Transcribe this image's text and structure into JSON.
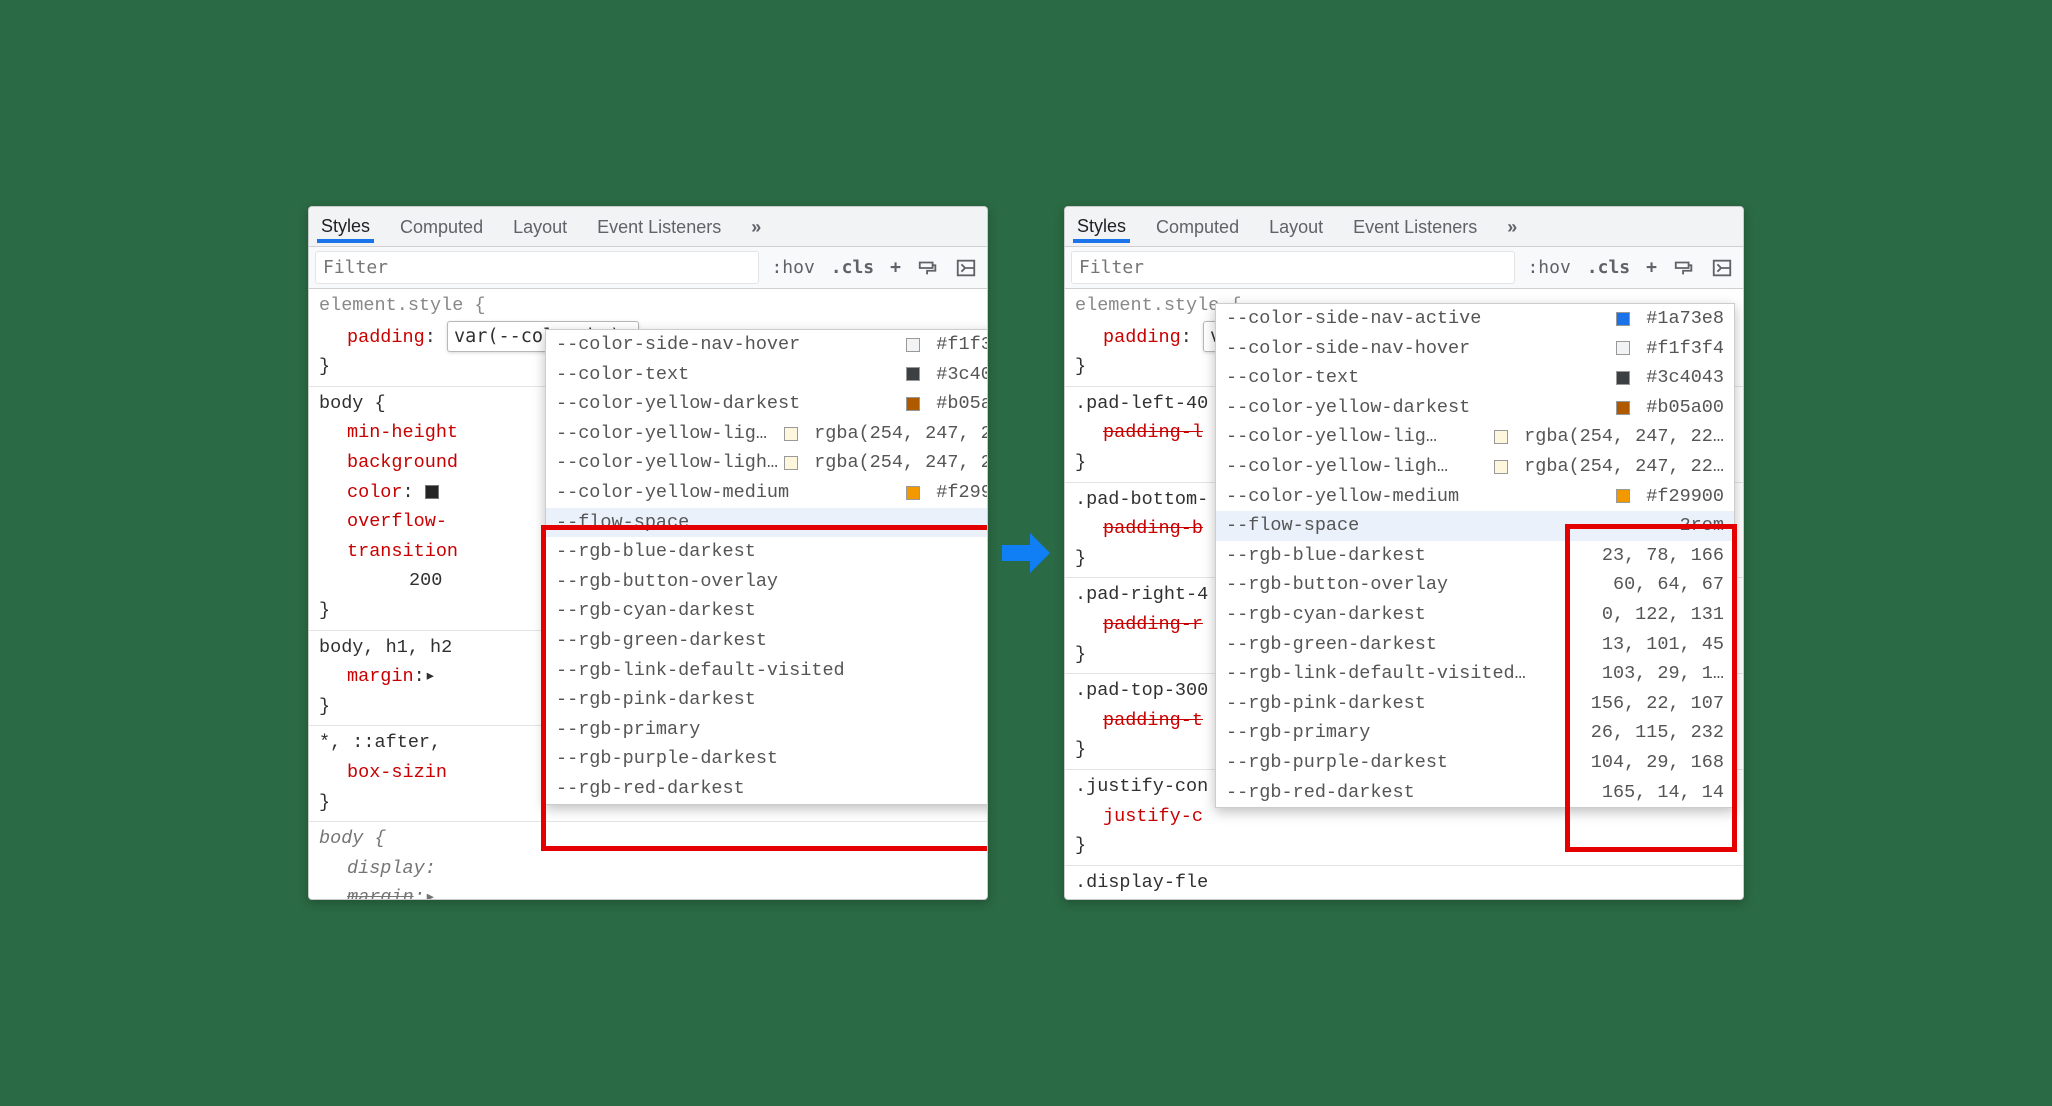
{
  "tabs": {
    "styles": "Styles",
    "computed": "Computed",
    "layout": "Layout",
    "events": "Event Listeners",
    "more": "»"
  },
  "toolbar": {
    "filter_placeholder": "Filter",
    "hov": ":hov",
    "cls": ".cls",
    "plus": "+"
  },
  "element_style": {
    "selector": "element.style {",
    "prop": "padding",
    "value_edit": "var(--color-bg);",
    "close": "}"
  },
  "left_rules": [
    {
      "selector": "body {",
      "props": [
        {
          "name": "min-height",
          "trailing": ""
        },
        {
          "name": "background",
          "trailing": ""
        },
        {
          "name": "color",
          "trailing": "",
          "swatch": "#242424"
        },
        {
          "name": "overflow-",
          "trailing": ""
        },
        {
          "name": "transition",
          "trailing": ""
        }
      ],
      "extra_indent_line": "200",
      "close": "}"
    },
    {
      "selector": "body, h1, h2",
      "props": [
        {
          "name": "margin",
          "trailing": ":▸"
        }
      ],
      "close": "}"
    },
    {
      "selector": "*, ::after,",
      "props": [
        {
          "name": "box-sizin",
          "trailing": ""
        }
      ],
      "close": "}"
    },
    {
      "selector_italic": "body {",
      "props": [
        {
          "name": "display",
          "italic": true,
          "trailing": ":"
        },
        {
          "name": "margin",
          "italic": true,
          "strike": true,
          "trailing": ":▸"
        }
      ]
    }
  ],
  "right_rules": [
    {
      "selector": ".pad-left-40",
      "props": [
        {
          "name": "padding-l",
          "strike": true
        }
      ],
      "close": "}"
    },
    {
      "selector": ".pad-bottom-",
      "props": [
        {
          "name": "padding-b",
          "strike": true
        }
      ],
      "close": "}"
    },
    {
      "selector": ".pad-right-4",
      "props": [
        {
          "name": "padding-r",
          "strike": true
        }
      ],
      "close": "}"
    },
    {
      "selector": ".pad-top-300",
      "props": [
        {
          "name": "padding-t",
          "strike": true
        }
      ],
      "close": "}"
    },
    {
      "selector": ".justify-con",
      "props": [
        {
          "name": "justify-c",
          "trailing": ""
        }
      ],
      "close": "}"
    },
    {
      "selector_partial": ".display-fle"
    }
  ],
  "dropdown_colors": [
    {
      "name": "--color-side-nav-active",
      "swatch": "#1a73e8",
      "val": "#1a73e8",
      "right_only": true
    },
    {
      "name": "--color-side-nav-hover",
      "swatch": "#f1f3f4",
      "val": "#f1f3f4"
    },
    {
      "name": "--color-text",
      "swatch": "#3c4043",
      "val": "#3c4043"
    },
    {
      "name": "--color-yellow-darkest",
      "swatch": "#b05a00",
      "val": "#b05a00"
    },
    {
      "name": "--color-yellow-lig…",
      "swatch": "rgba(254,247,222,1)",
      "val": "rgba(254, 247, 22…"
    },
    {
      "name": "--color-yellow-ligh…",
      "swatch": "rgba(254,247,222,1)",
      "val": "rgba(254, 247, 22…"
    },
    {
      "name": "--color-yellow-medium",
      "swatch": "#f29900",
      "val": "#f29900"
    }
  ],
  "dropdown_plain_left": [
    {
      "name": "--flow-space",
      "selected": true
    },
    {
      "name": "--rgb-blue-darkest"
    },
    {
      "name": "--rgb-button-overlay"
    },
    {
      "name": "--rgb-cyan-darkest"
    },
    {
      "name": "--rgb-green-darkest"
    },
    {
      "name": "--rgb-link-default-visited"
    },
    {
      "name": "--rgb-pink-darkest"
    },
    {
      "name": "--rgb-primary"
    },
    {
      "name": "--rgb-purple-darkest"
    },
    {
      "name": "--rgb-red-darkest"
    }
  ],
  "dropdown_plain_right": [
    {
      "name": "--flow-space",
      "val": "2rem",
      "selected": true
    },
    {
      "name": "--rgb-blue-darkest",
      "val": "23, 78, 166"
    },
    {
      "name": "--rgb-button-overlay",
      "val": "60, 64, 67"
    },
    {
      "name": "--rgb-cyan-darkest",
      "val": "0, 122, 131"
    },
    {
      "name": "--rgb-green-darkest",
      "val": "13, 101, 45"
    },
    {
      "name": "--rgb-link-default-visited…",
      "val": "103, 29, 1…"
    },
    {
      "name": "--rgb-pink-darkest",
      "val": "156, 22, 107"
    },
    {
      "name": "--rgb-primary",
      "val": "26, 115, 232"
    },
    {
      "name": "--rgb-purple-darkest",
      "val": "104, 29, 168"
    },
    {
      "name": "--rgb-red-darkest",
      "val": "165, 14, 14"
    }
  ]
}
